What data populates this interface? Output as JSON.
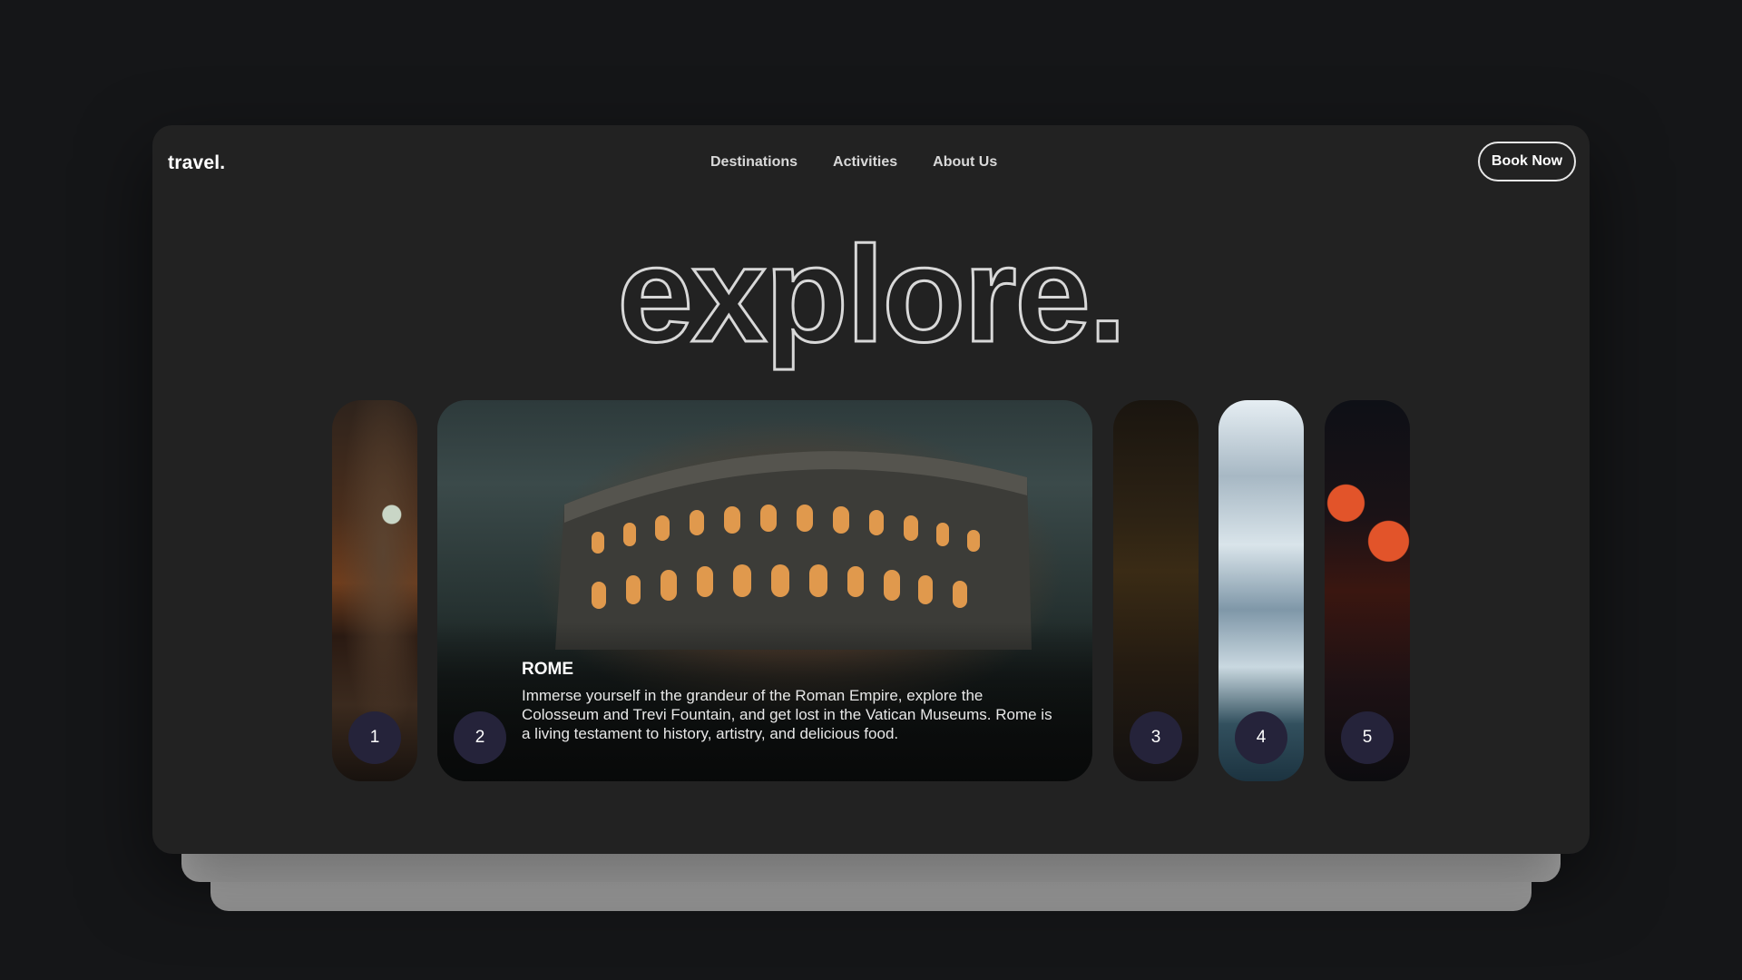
{
  "header": {
    "logo": "travel.",
    "nav": [
      "Destinations",
      "Activities",
      "About Us"
    ],
    "cta_label": "Book Now"
  },
  "hero": {
    "title": "explore."
  },
  "cards": [
    {
      "number": "1"
    },
    {
      "number": "2",
      "title": "ROME",
      "description": "Immerse yourself in the grandeur of the Roman Empire, explore the Colosseum and Trevi Fountain, and get lost in the Vatican Museums. Rome is a living testament to history, artistry, and delicious food."
    },
    {
      "number": "3"
    },
    {
      "number": "4"
    },
    {
      "number": "5"
    }
  ],
  "colors": {
    "background": "#151618",
    "panel": "#222222",
    "badge": "#25233a",
    "text": "#ffffff"
  }
}
